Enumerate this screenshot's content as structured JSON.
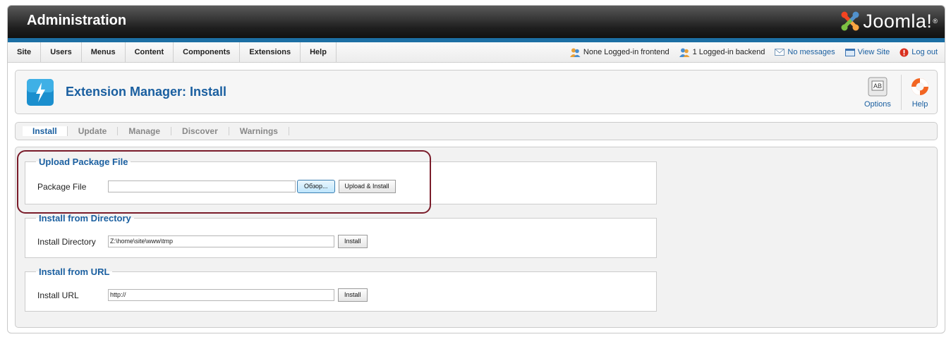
{
  "header": {
    "title": "Administration",
    "logo_text": "Joomla!",
    "logo_tm": "®"
  },
  "menu": {
    "items": [
      {
        "label": "Site"
      },
      {
        "label": "Users"
      },
      {
        "label": "Menus"
      },
      {
        "label": "Content"
      },
      {
        "label": "Components"
      },
      {
        "label": "Extensions"
      },
      {
        "label": "Help"
      }
    ]
  },
  "status": {
    "frontend": "None Logged-in frontend",
    "backend": "1 Logged-in backend",
    "messages": "No messages",
    "view_site": "View Site",
    "logout": "Log out"
  },
  "toolbar": {
    "page_title": "Extension Manager: Install",
    "options_label": "Options",
    "help_label": "Help"
  },
  "tabs": [
    {
      "label": "Install",
      "active": true
    },
    {
      "label": "Update",
      "active": false
    },
    {
      "label": "Manage",
      "active": false
    },
    {
      "label": "Discover",
      "active": false
    },
    {
      "label": "Warnings",
      "active": false
    }
  ],
  "upload": {
    "legend": "Upload Package File",
    "label": "Package File",
    "value": "",
    "browse_label": "Обзор...",
    "submit_label": "Upload & Install"
  },
  "directory": {
    "legend": "Install from Directory",
    "label": "Install Directory",
    "value": "Z:\\home\\site\\www\\tmp",
    "submit_label": "Install"
  },
  "url": {
    "legend": "Install from URL",
    "label": "Install URL",
    "value": "http://",
    "submit_label": "Install"
  },
  "colors": {
    "accent": "#1a5fa0",
    "header_bar": "#1c6fa4",
    "highlight": "#7a1c2a"
  }
}
